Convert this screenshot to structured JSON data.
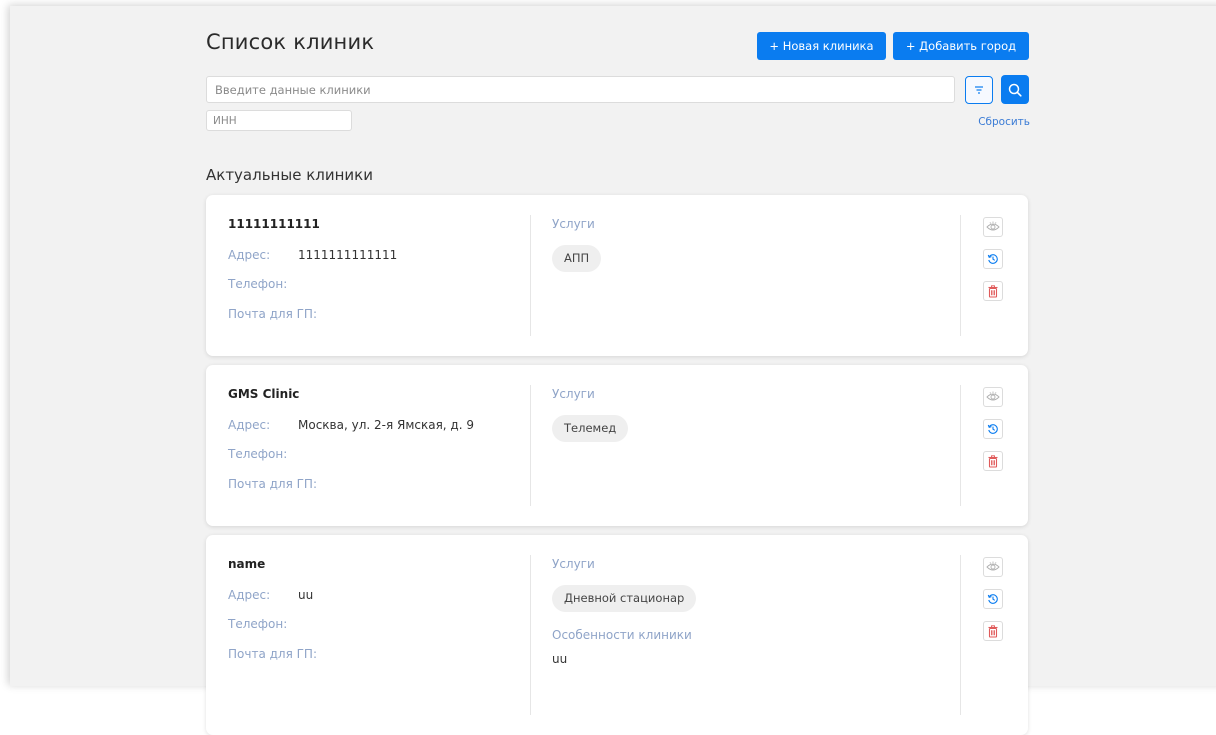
{
  "header": {
    "title": "Список клиник",
    "new_clinic_label": "+ Новая клиника",
    "add_city_label": "+ Добавить город"
  },
  "search": {
    "placeholder": "Введите данные клиники",
    "value": "",
    "inn_placeholder": "ИНН",
    "inn_value": "",
    "reset_label": "Сбросить",
    "filter_icon": "filter-icon",
    "search_icon": "search-icon"
  },
  "section": {
    "title": "Актуальные клиники"
  },
  "labels": {
    "address": "Адрес:",
    "phone": "Телефон:",
    "mail": "Почта для ГП:",
    "services": "Услуги",
    "features": "Особенности клиники"
  },
  "clinics": [
    {
      "name": "11111111111",
      "address": "1111111111111",
      "phone": "",
      "mail": "",
      "services": [
        "АПП"
      ]
    },
    {
      "name": "GMS Clinic",
      "address": "Москва, ул. 2-я Ямская, д. 9",
      "phone": "",
      "mail": "",
      "services": [
        "Телемед"
      ]
    },
    {
      "name": "name",
      "address": "uu",
      "phone": "",
      "mail": "",
      "services": [
        "Дневной стационар"
      ],
      "features": "uu"
    }
  ],
  "actions": {
    "view_icon": "eye-icon",
    "history_icon": "history-icon",
    "delete_icon": "trash-icon"
  },
  "colors": {
    "accent": "#0a7cf0",
    "label": "#8fa4c8",
    "danger": "#e05a5a",
    "background": "#f2f2f2"
  }
}
